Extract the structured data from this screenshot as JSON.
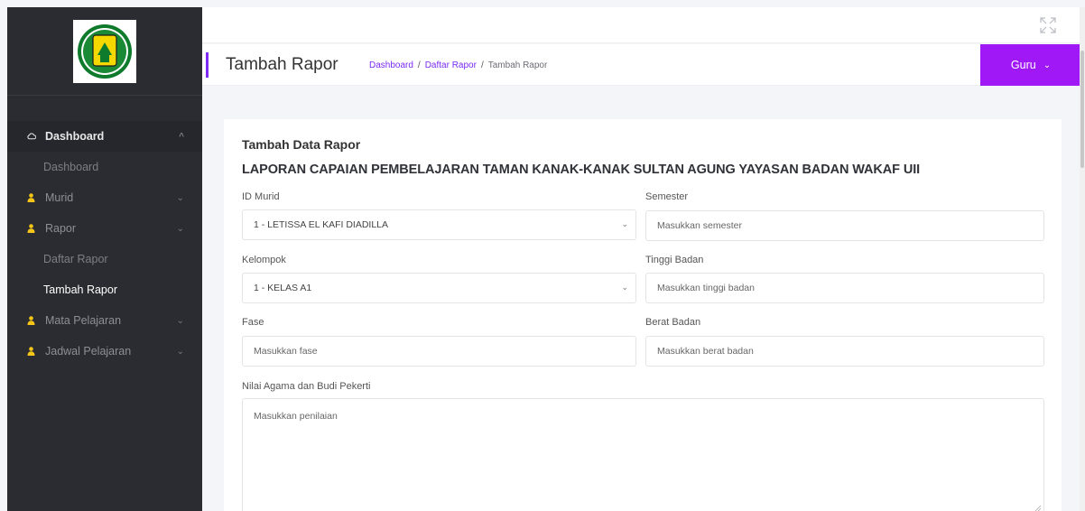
{
  "sidebar": {
    "menu": {
      "dashboard": {
        "label": "Dashboard",
        "sub": "Dashboard"
      },
      "murid": {
        "label": "Murid"
      },
      "rapor": {
        "label": "Rapor",
        "sub1": "Daftar Rapor",
        "sub2": "Tambah Rapor"
      },
      "mapel": {
        "label": "Mata Pelajaran"
      },
      "jadwal": {
        "label": "Jadwal Pelajaran"
      }
    }
  },
  "header": {
    "title": "Tambah Rapor",
    "breadcrumb": [
      "Dashboard",
      "Daftar Rapor",
      "Tambah Rapor"
    ],
    "user_label": "Guru"
  },
  "form": {
    "title": "Tambah Data Rapor",
    "subtitle": "LAPORAN CAPAIAN PEMBELAJARAN TAMAN KANAK-KANAK SULTAN AGUNG YAYASAN BADAN WAKAF UII",
    "id_murid": {
      "label": "ID Murid",
      "value": "1 - LETISSA EL KAFI DIADILLA"
    },
    "semester": {
      "label": "Semester",
      "placeholder": "Masukkan semester"
    },
    "kelompok": {
      "label": "Kelompok",
      "value": "1 - KELAS A1"
    },
    "tinggi": {
      "label": "Tinggi Badan",
      "placeholder": "Masukkan tinggi badan"
    },
    "fase": {
      "label": "Fase",
      "placeholder": "Masukkan fase"
    },
    "berat": {
      "label": "Berat Badan",
      "placeholder": "Masukkan berat badan"
    },
    "nilai_agama": {
      "label": "Nilai Agama dan Budi Pekerti",
      "placeholder": "Masukkan penilaian"
    }
  },
  "colors": {
    "accent": "#7c2bf5",
    "user_button": "#a018f5",
    "sidebar_bg": "#2b2c31",
    "icon_yellow": "#f5c518"
  },
  "icons": {
    "logo": "school-logo",
    "dashboard": "cloud-icon",
    "menu_item": "person-icon",
    "expand": "fullscreen-icon",
    "chevron": "chevron-down-icon"
  }
}
